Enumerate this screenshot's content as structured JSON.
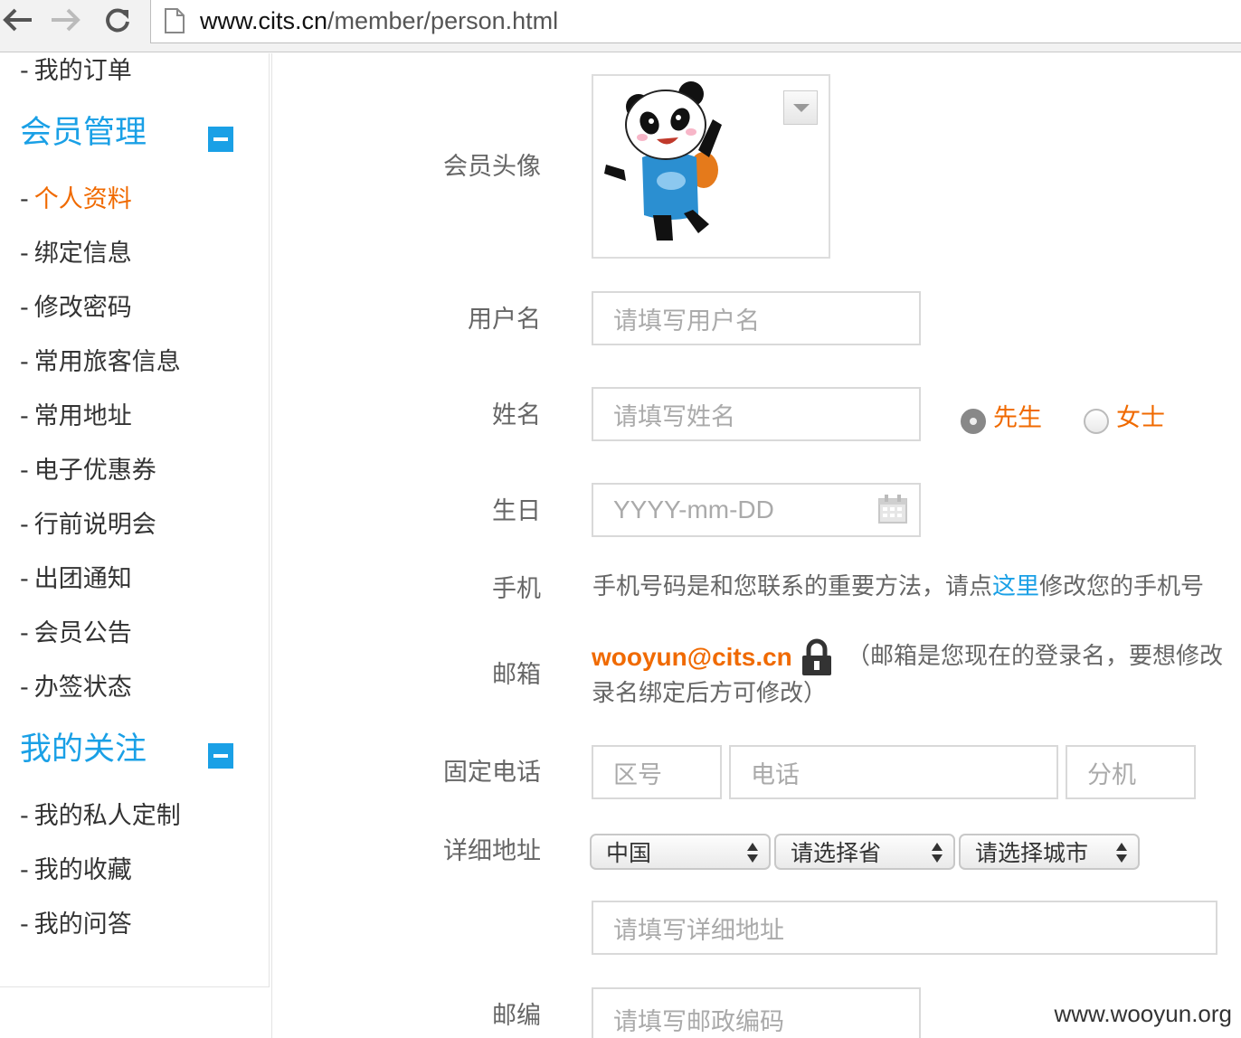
{
  "browser": {
    "url_domain": "www.cits.cn",
    "url_path": "/member/person.html"
  },
  "sidebar": {
    "top_item": "我的订单",
    "dash": "-",
    "group1": {
      "title": "会员管理",
      "items": [
        "个人资料",
        "绑定信息",
        "修改密码",
        "常用旅客信息",
        "常用地址",
        "电子优惠券",
        "行前说明会",
        "出团通知",
        "会员公告",
        "办签状态"
      ],
      "active": "个人资料"
    },
    "group2": {
      "title": "我的关注",
      "items": [
        "我的私人定制",
        "我的收藏",
        "我的问答"
      ]
    }
  },
  "form": {
    "avatar_label": "会员头像",
    "username_label": "用户名",
    "username_placeholder": "请填写用户名",
    "name_label": "姓名",
    "name_placeholder": "请填写姓名",
    "gender_options": [
      "先生",
      "女士"
    ],
    "gender_selected": "先生",
    "birthday_label": "生日",
    "birthday_placeholder": "YYYY-mm-DD",
    "phone_label": "手机",
    "phone_text_before": "手机号码是和您联系的重要方法，请点",
    "phone_link": "这里",
    "phone_text_after": "修改您的手机号",
    "email_label": "邮箱",
    "email_value": "wooyun@cits.cn",
    "email_note_line1": "（邮箱是您现在的登录名，要想修改",
    "email_note_line2": "录名绑定后方可修改）",
    "landline_label": "固定电话",
    "area_code_placeholder": "区号",
    "phone_placeholder": "电话",
    "extension_placeholder": "分机",
    "address_label": "详细地址",
    "country_value": "中国",
    "province_value": "请选择省",
    "city_value": "请选择城市",
    "address_placeholder": "请填写详细地址",
    "zip_label": "邮编",
    "zip_placeholder": "请填写邮政编码"
  },
  "colors": {
    "accent_blue": "#1aa0e6",
    "accent_orange": "#f06a00"
  },
  "watermark": "www.wooyun.org"
}
